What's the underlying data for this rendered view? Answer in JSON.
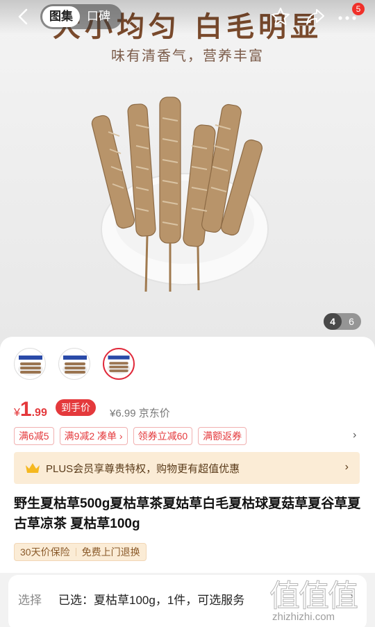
{
  "hero": {
    "heading": "大小均匀 白毛明显",
    "subheading": "味有清香气，营养丰富",
    "counter_current": "4",
    "counter_total": "6"
  },
  "nav": {
    "tabs": [
      {
        "label": "图集",
        "active": true
      },
      {
        "label": "口碑",
        "active": false
      }
    ],
    "icons": [
      "back-icon",
      "star-icon",
      "share-icon",
      "more-icon"
    ],
    "badge_count": "5"
  },
  "product": {
    "price_symbol": "¥",
    "price_integer": "1",
    "price_decimal": ".99",
    "price_tag": "到手价",
    "jd_price": "¥6.99 京东价",
    "promos": [
      "满6减5",
      "满9减2 凑单 ›",
      "领券立减60",
      "满额返券"
    ],
    "plus_text": "PLUS会员享尊贵特权，购物更有超值优惠",
    "title": "野生夏枯草500g夏枯草茶夏姑草白毛夏枯球夏菇草夏谷草夏古草凉茶 夏枯草100g",
    "services": [
      "30天价保险",
      "免费上门退换"
    ],
    "thumbnail_count": 3,
    "selected_thumbnail_index": 2
  },
  "selection": {
    "label": "选择",
    "value": "已选：夏枯草100g，1件，可选服务",
    "arrow": "›"
  },
  "watermark": {
    "glyphs": "值值值",
    "url": "zhizhizhi.com"
  },
  "colors": {
    "accent_red": "#e4393c",
    "plus_bg": "#fbecd6",
    "hero_heading": "#7a4a2c"
  }
}
